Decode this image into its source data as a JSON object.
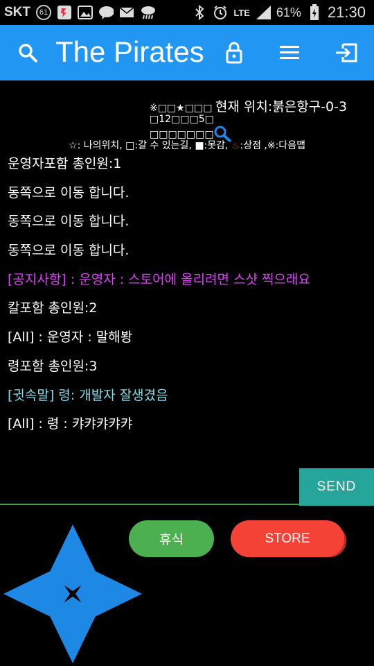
{
  "status_bar": {
    "carrier": "SKT",
    "badge": "61",
    "network": "LTE",
    "battery": "61%",
    "time": "21:30"
  },
  "app_bar": {
    "title": "The Pirates",
    "icons": [
      "search-icon",
      "lock-icon",
      "menu-icon",
      "exit-icon"
    ]
  },
  "map": {
    "row1_cells": "※□□★□□□",
    "location": "현재 위치:붉은항구-0-3",
    "row2_cells": "□12□□□5□",
    "row3_cells": "□□□□□□□",
    "legend": {
      "part1": "☆: 나의위치, □:갈 수 있는길, ■:못감, ",
      "hot_spring": "♨",
      "part2": ":상점 ,※:다음맵"
    }
  },
  "messages": [
    {
      "text": "운영자포함 총인원:1",
      "kind": "system"
    },
    {
      "text": "동쪽으로 이동 합니다.",
      "kind": "system"
    },
    {
      "text": "동쪽으로 이동 합니다.",
      "kind": "system"
    },
    {
      "text": "동쪽으로 이동 합니다.",
      "kind": "system"
    },
    {
      "text": "[공지사항] : 운영자 : 스토어에 올리려면 스샷 찍으래요",
      "kind": "notice"
    },
    {
      "text": "칼포함 총인원:2",
      "kind": "system"
    },
    {
      "text": "[All] : 운영자 : 말해봥",
      "kind": "chat"
    },
    {
      "text": "령포함 총인원:3",
      "kind": "system"
    },
    {
      "text": "[귓속말] 령: 개발자 잘생겼음",
      "kind": "whisper"
    },
    {
      "text": "[All] : 령 : 캬캬캬캬캬",
      "kind": "chat"
    }
  ],
  "chat_input": {
    "value": "",
    "placeholder": ""
  },
  "buttons": {
    "send": "SEND",
    "rest": "휴식",
    "store": "STORE"
  },
  "colors": {
    "app_bar": "#2196F3",
    "send": "#26a69a",
    "rest": "#4caf50",
    "store": "#f44336",
    "dpad": "#1e88e5",
    "notice": "#e040fb",
    "whisper": "#80deea"
  }
}
